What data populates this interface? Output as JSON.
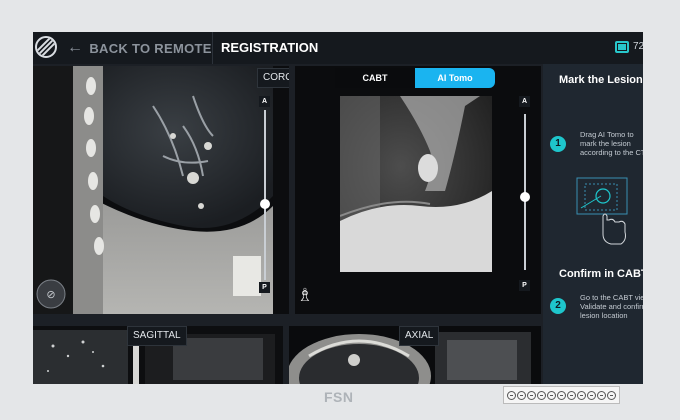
{
  "header": {
    "back_label": "BACK TO REMOTE",
    "title": "REGISTRATION",
    "battery_text": "72"
  },
  "coronal": {
    "label": "CORONAL",
    "top_marker": "A",
    "bottom_marker": "P",
    "slider_fraction": 0.55
  },
  "tomo": {
    "tabs": [
      {
        "label": "CABT",
        "active": false
      },
      {
        "label": "AI Tomo",
        "active": true
      }
    ],
    "top_marker": "A",
    "bottom_marker": "P",
    "slider_fraction": 0.53
  },
  "sagittal": {
    "label": "SAGITTAL"
  },
  "axial": {
    "label": "AXIAL"
  },
  "instructions": {
    "steps": [
      {
        "heading": "Mark the Lesion",
        "number": "1",
        "text": "Drag AI Tomo to mark the lesion according to the CT"
      },
      {
        "heading": "Confirm in CABT",
        "number": "2",
        "text": "Go to the CABT view Validate and confirm lesion location"
      }
    ]
  },
  "footer": {
    "brand": "FSN"
  },
  "colors": {
    "accent": "#1ec6cc",
    "tab_active": "#1ab4f0",
    "background": "#1c2026"
  }
}
